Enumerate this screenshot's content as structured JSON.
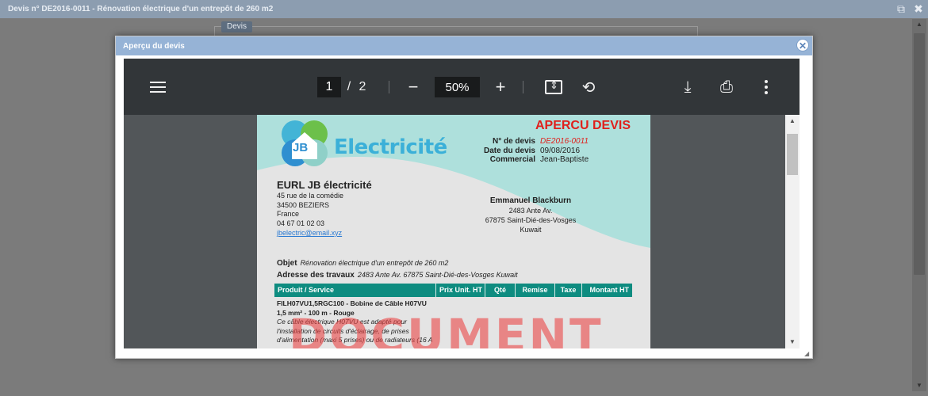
{
  "window": {
    "title": "Devis n° DE2016-0011 - Rénovation électrique d'un entrepôt de 260 m2",
    "restore_icon": "restore-icon",
    "close_icon": "close-icon",
    "tab_label": "Devis"
  },
  "modal": {
    "title": "Aperçu du devis",
    "close_glyph": "✕"
  },
  "viewer": {
    "current_page": "1",
    "page_separator": "/",
    "total_pages": "2",
    "zoom": "50%",
    "zoom_out_glyph": "−",
    "zoom_in_glyph": "+",
    "icons": [
      "menu-icon",
      "fit-page-icon",
      "rotate-icon",
      "download-icon",
      "print-icon",
      "more-options-icon"
    ]
  },
  "document": {
    "logo_text": "Electricité",
    "logo_badge": "JB",
    "preview_label": "APERCU DEVIS",
    "meta": [
      {
        "label": "N° de devis",
        "value": "DE2016-0011"
      },
      {
        "label": "Date du devis",
        "value": "09/08/2016"
      },
      {
        "label": "Commercial",
        "value": "Jean-Baptiste"
      }
    ],
    "company": {
      "name": "EURL JB électricité",
      "address1": "45 rue de la comédie",
      "address2": "34500 BEZIERS",
      "country": "France",
      "phone": "04 67 01 02 03",
      "email": "jbelectric@email.xyz"
    },
    "client": {
      "name": "Emmanuel Blackburn",
      "address1": "2483 Ante Av.",
      "address2": "67875 Saint-Dié-des-Vosges",
      "country": "Kuwait"
    },
    "objet_label": "Objet",
    "objet_value": "Rénovation électrique d'un entrepôt de 260 m2",
    "adresse_label": "Adresse des travaux",
    "adresse_value": "2483 Ante Av. 67875 Saint-Dié-des-Vosges Kuwait",
    "table_headers": [
      "Produit / Service",
      "Prix Unit. HT",
      "Qté",
      "Remise",
      "Taxe",
      "Montant HT"
    ],
    "item": {
      "name_line1": "FILH07VU1,5RGC100 - Bobine de Câble H07VU",
      "name_line2": "1,5 mm² - 100 m - Rouge",
      "desc_line1": "Ce câble électrique H07VU est adapté pour",
      "desc_line2": "l'installation de circuits d'éclairage, de prises",
      "desc_line3": "d'alimentation (maxi 5 prises) ou de radiateurs (16 A"
    },
    "watermark": "DOCUMENT"
  },
  "colors": {
    "modal_header": "#96b3d6",
    "table_header": "#0e8c80",
    "accent_red": "#e0201c",
    "logo_blue": "#3bb0d8",
    "swoosh": "#aee0dc"
  }
}
